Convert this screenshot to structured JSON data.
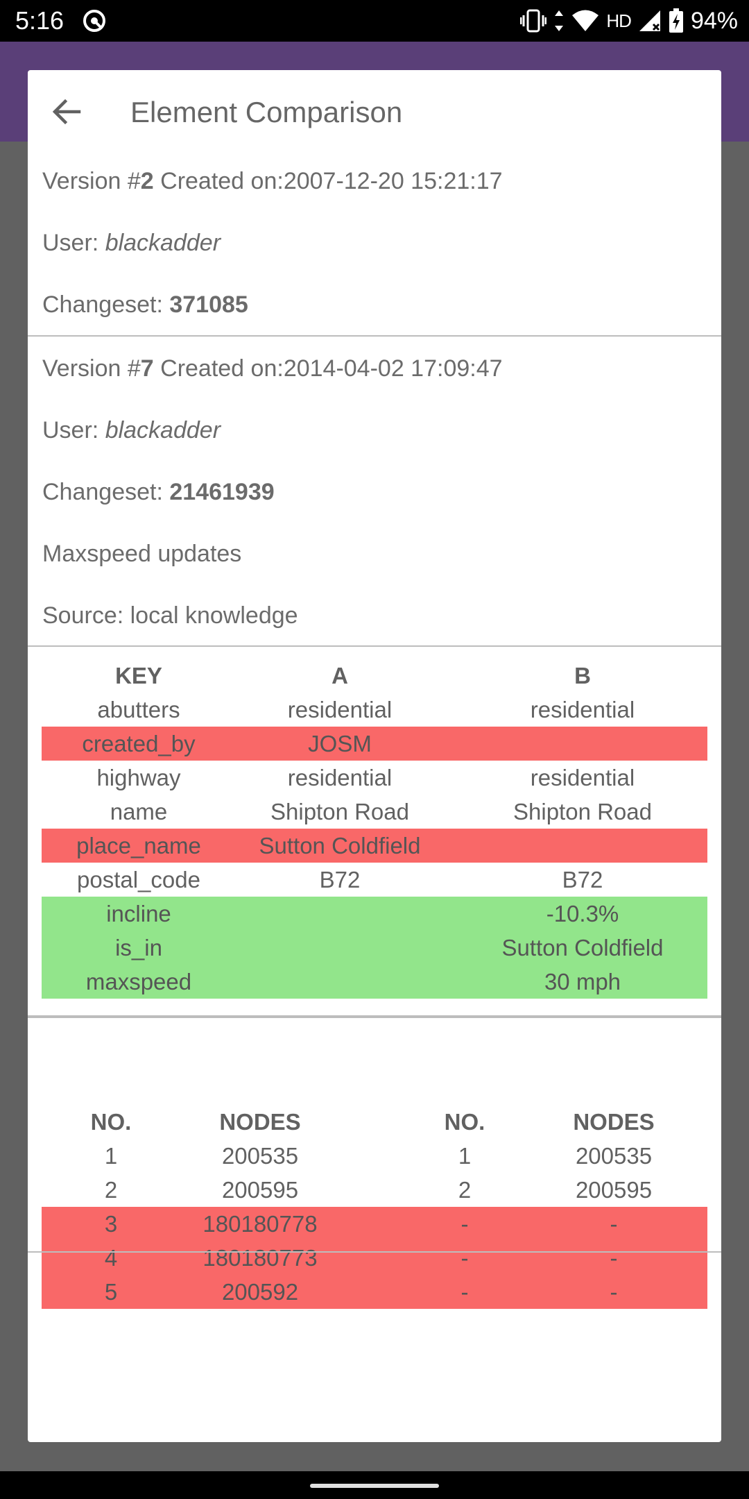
{
  "status_bar": {
    "time": "5:16",
    "icons": [
      "app-notification-icon",
      "vibrate-icon",
      "data-arrows-icon",
      "wifi-icon",
      "signal-icon",
      "battery-charging-icon"
    ],
    "network": "HD",
    "battery": "94%"
  },
  "dialog": {
    "title": "Element Comparison",
    "version_a": {
      "version_prefix": "Version #",
      "version_number": "2",
      "created_label": " Created on:",
      "created_on": "2007-12-20 15:21:17",
      "user_label": "User: ",
      "user": "blackadder",
      "changeset_label": "Changeset: ",
      "changeset": "371085"
    },
    "version_b": {
      "version_prefix": "Version #",
      "version_number": "7",
      "created_label": " Created on:",
      "created_on": "2014-04-02 17:09:47",
      "user_label": "User: ",
      "user": "blackadder",
      "changeset_label": "Changeset: ",
      "changeset": "21461939",
      "comment": "Maxspeed updates",
      "source": "Source: local knowledge"
    },
    "tag_table": {
      "headers": [
        "KEY",
        "A",
        "B"
      ],
      "rows": [
        {
          "key": "abutters",
          "a": "residential",
          "b": "residential",
          "status": "same"
        },
        {
          "key": "created_by",
          "a": "JOSM",
          "b": "",
          "status": "removed"
        },
        {
          "key": "highway",
          "a": "residential",
          "b": "residential",
          "status": "same"
        },
        {
          "key": "name",
          "a": "Shipton Road",
          "b": "Shipton Road",
          "status": "same"
        },
        {
          "key": "place_name",
          "a": "Sutton Coldfield",
          "b": "",
          "status": "removed"
        },
        {
          "key": "postal_code",
          "a": "B72",
          "b": "B72",
          "status": "same"
        },
        {
          "key": "incline",
          "a": "",
          "b": "-10.3%",
          "status": "added"
        },
        {
          "key": "is_in",
          "a": "",
          "b": "Sutton Coldfield",
          "status": "added"
        },
        {
          "key": "maxspeed",
          "a": "",
          "b": "30 mph",
          "status": "added"
        }
      ]
    },
    "node_table": {
      "headers": [
        "NO.",
        "NODES",
        "NO.",
        "NODES"
      ],
      "rows": [
        {
          "no_a": "1",
          "node_a": "200535",
          "no_b": "1",
          "node_b": "200535",
          "status": "same"
        },
        {
          "no_a": "2",
          "node_a": "200595",
          "no_b": "2",
          "node_b": "200595",
          "status": "same"
        },
        {
          "no_a": "3",
          "node_a": "180180778",
          "no_b": "-",
          "node_b": "-",
          "status": "removed"
        },
        {
          "no_a": "4",
          "node_a": "180180773",
          "no_b": "-",
          "node_b": "-",
          "status": "removed"
        },
        {
          "no_a": "5",
          "node_a": "200592",
          "no_b": "-",
          "node_b": "-",
          "status": "removed"
        }
      ]
    }
  },
  "colors": {
    "removed": "#f96868",
    "added": "#92e58b",
    "app_bar": "#5a3f78",
    "scrim": "#616161"
  }
}
